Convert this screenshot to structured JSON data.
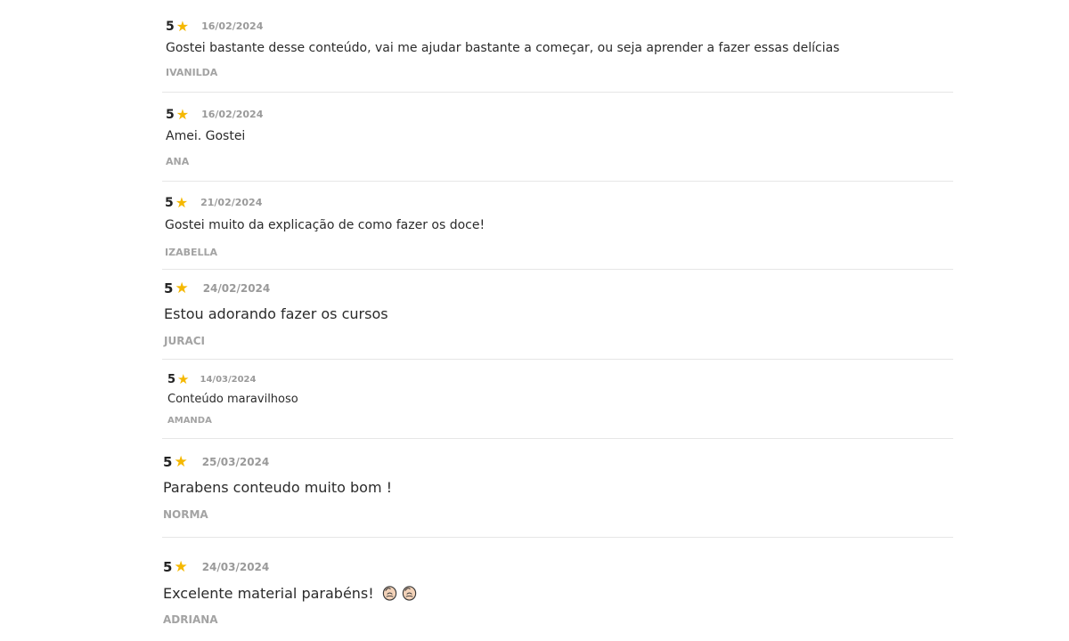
{
  "colors": {
    "star": "#f5b800",
    "date": "#9a9a9a",
    "author": "#a3a3a3",
    "divider": "#e6e6e6"
  },
  "reviews": [
    {
      "rating": "5",
      "date": "16/02/2024",
      "text": "Gostei bastante desse conteúdo, vai me ajudar bastante a começar, ou seja aprender a fazer essas delícias",
      "author": "IVANILDA"
    },
    {
      "rating": "5",
      "date": "16/02/2024",
      "text": "Amei. Gostei",
      "author": "ANA"
    },
    {
      "rating": "5",
      "date": "21/02/2024",
      "text": "Gostei muito da explicação de como fazer os doce!",
      "author": "IZABELLA"
    },
    {
      "rating": "5",
      "date": "24/02/2024",
      "text": "Estou adorando fazer os cursos",
      "author": "JURACI"
    },
    {
      "rating": "5",
      "date": "14/03/2024",
      "text": "Conteúdo maravilhoso",
      "author": "AMANDA"
    },
    {
      "rating": "5",
      "date": "25/03/2024",
      "text": "Parabens conteudo muito bom !",
      "author": "NORMA"
    },
    {
      "rating": "5",
      "date": "24/03/2024",
      "text": "Excelente material parabéns!",
      "author": "ADRIANA",
      "icons": [
        "clapping-hands-icon",
        "clapping-hands-icon"
      ]
    }
  ]
}
